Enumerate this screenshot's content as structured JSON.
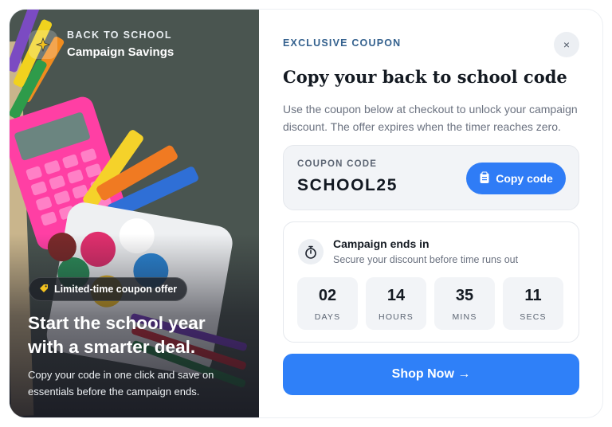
{
  "left_panel": {
    "eyebrow": "BACK TO SCHOOL",
    "title": "Campaign Savings",
    "badge_icon": "sparkle-icon",
    "pill_icon": "tag-icon",
    "pill_label": "Limited-time coupon offer",
    "hero_title": "Start the school year with a smarter deal.",
    "hero_text": "Copy your code in one click and save on essentials before the campaign ends."
  },
  "right_panel": {
    "eyebrow": "EXCLUSIVE COUPON",
    "title": "Copy your back to school code",
    "description": "Use the coupon below at checkout to unlock your campaign discount. The offer expires when the timer reaches zero.",
    "close_label": "×",
    "close_icon": "close-icon"
  },
  "coupon": {
    "label": "COUPON CODE",
    "code": "SCHOOL25",
    "copy_label": "Copy code",
    "copy_icon": "clipboard-icon"
  },
  "timer": {
    "icon": "stopwatch-icon",
    "title": "Campaign ends in",
    "subtitle": "Secure your discount before time runs out",
    "units": [
      {
        "value": "02",
        "label": "DAYS"
      },
      {
        "value": "14",
        "label": "HOURS"
      },
      {
        "value": "35",
        "label": "MINS"
      },
      {
        "value": "11",
        "label": "SECS"
      }
    ]
  },
  "shop_button": {
    "label": "Shop Now →"
  },
  "colors": {
    "accent": "#2f7cf6",
    "eyebrow": "#34618e",
    "panel_bg": "#f2f4f7"
  }
}
